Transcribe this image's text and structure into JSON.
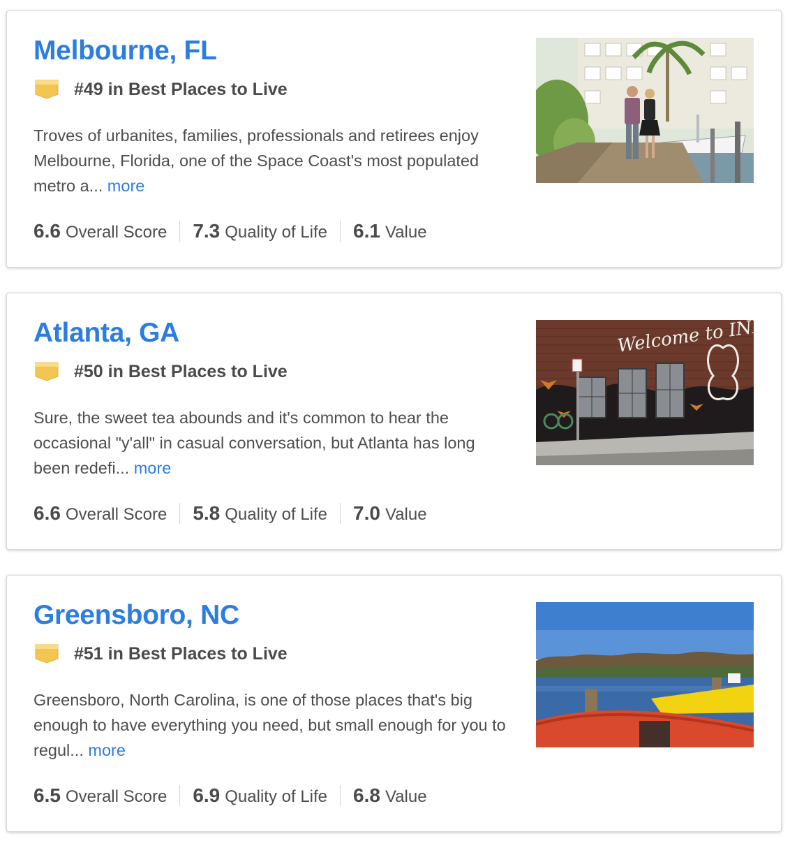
{
  "listings": [
    {
      "city": "Melbourne, FL",
      "rank_text": "#49 in Best Places to Live",
      "description": "Troves of urbanites, families, professionals and retirees enjoy Melbourne, Florida, one of the Space Coast's most populated metro a...",
      "more_label": "more",
      "scores": [
        {
          "value": "6.6",
          "label": "Overall Score"
        },
        {
          "value": "7.3",
          "label": "Quality of Life"
        },
        {
          "value": "6.1",
          "label": "Value"
        }
      ]
    },
    {
      "city": "Atlanta, GA",
      "rank_text": "#50 in Best Places to Live",
      "description": "Sure, the sweet tea abounds and it's common to hear the occasional \"y'all\" in casual conversation, but Atlanta has long been redefi...",
      "more_label": "more",
      "scores": [
        {
          "value": "6.6",
          "label": "Overall Score"
        },
        {
          "value": "5.8",
          "label": "Quality of Life"
        },
        {
          "value": "7.0",
          "label": "Value"
        }
      ]
    },
    {
      "city": "Greensboro, NC",
      "rank_text": "#51 in Best Places to Live",
      "description": "Greensboro, North Carolina, is one of those places that's big enough to have everything you need, but small enough for you to regul...",
      "more_label": "more",
      "scores": [
        {
          "value": "6.5",
          "label": "Overall Score"
        },
        {
          "value": "6.9",
          "label": "Quality of Life"
        },
        {
          "value": "6.8",
          "label": "Value"
        }
      ]
    }
  ],
  "photo_texts": {
    "atlanta_mural": "Welcome to INMANPARK"
  },
  "colors": {
    "link": "#2b7de1",
    "badge": "#f3c651",
    "text": "#4d4d4d"
  },
  "icons": {
    "rank_badge": "ranking-badge-icon"
  }
}
